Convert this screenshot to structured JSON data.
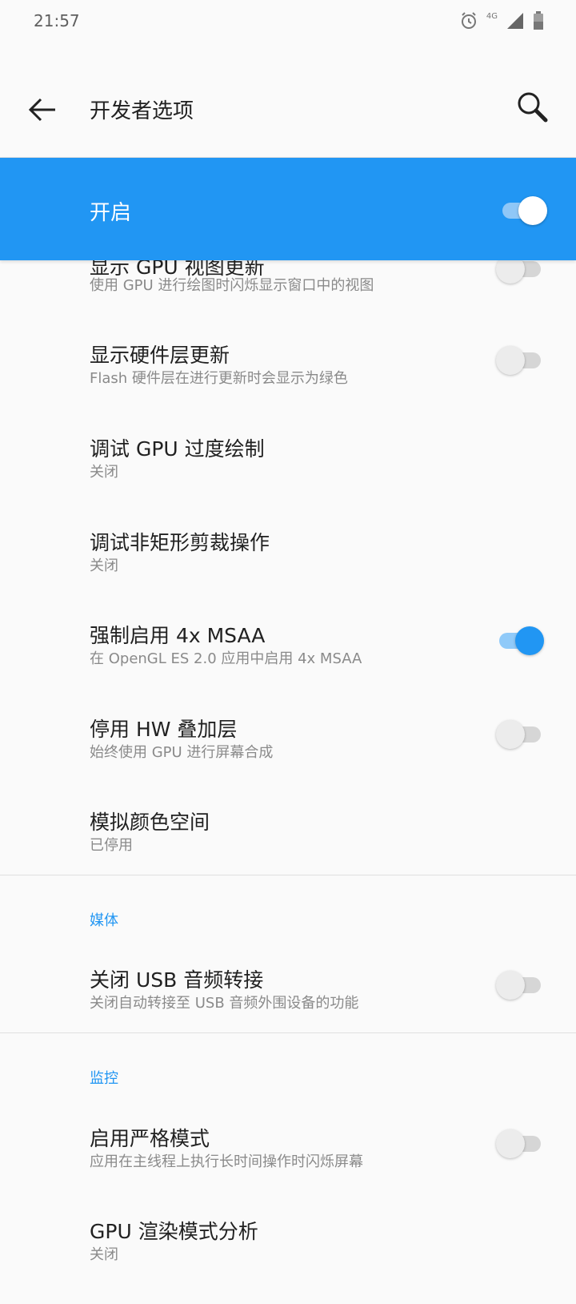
{
  "status": {
    "time": "21:57",
    "network": "4G"
  },
  "header": {
    "title": "开发者选项"
  },
  "master": {
    "label": "开启",
    "enabled": true
  },
  "items": [
    {
      "title": "显示 GPU 视图更新",
      "summary": "使用 GPU 进行绘图时闪烁显示窗口中的视图",
      "switch": false
    },
    {
      "title": "显示硬件层更新",
      "summary": "Flash 硬件层在进行更新时会显示为绿色",
      "switch": false
    },
    {
      "title": "调试 GPU 过度绘制",
      "summary": "关闭"
    },
    {
      "title": "调试非矩形剪裁操作",
      "summary": "关闭"
    },
    {
      "title": "强制启用 4x MSAA",
      "summary": "在 OpenGL ES 2.0 应用中启用 4x MSAA",
      "switch": true
    },
    {
      "title": "停用 HW 叠加层",
      "summary": "始终使用 GPU 进行屏幕合成",
      "switch": false
    },
    {
      "title": "模拟颜色空间",
      "summary": "已停用"
    }
  ],
  "sections": {
    "media": {
      "header": "媒体",
      "items": [
        {
          "title": "关闭 USB 音频转接",
          "summary": "关闭自动转接至 USB 音频外围设备的功能",
          "switch": false
        }
      ]
    },
    "monitor": {
      "header": "监控",
      "items": [
        {
          "title": "启用严格模式",
          "summary": "应用在主线程上执行长时间操作时闪烁屏幕",
          "switch": false
        },
        {
          "title": "GPU 渲染模式分析",
          "summary": "关闭"
        }
      ]
    }
  },
  "colors": {
    "accent": "#2196f3",
    "background": "#fafafa",
    "text_primary": "#212121",
    "text_secondary": "#8a8a8a"
  },
  "icons": {
    "back": "arrow-left-icon",
    "search": "search-icon",
    "alarm": "alarm-icon",
    "signal": "signal-icon",
    "battery": "battery-icon"
  }
}
